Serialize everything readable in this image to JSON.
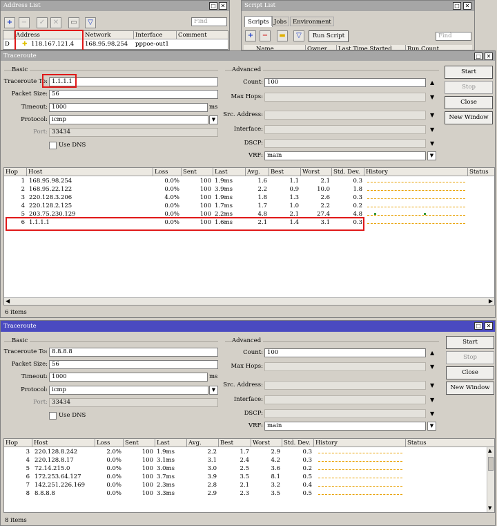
{
  "address_list": {
    "title": "Address List",
    "find_placeholder": "Find",
    "columns": [
      "Address",
      "Network",
      "Interface",
      "Comment"
    ],
    "row": {
      "flag": "D",
      "address": "118.167.121.4",
      "network": "168.95.98.254",
      "interface": "pppoe-out1",
      "comment": ""
    }
  },
  "script_list": {
    "title": "Script List",
    "tabs": [
      "Scripts",
      "Jobs",
      "Environment"
    ],
    "run_script": "Run Script",
    "find_placeholder": "Find",
    "columns": [
      "Name",
      "Owner",
      "Last Time Started",
      "Run Count"
    ]
  },
  "window_controls": {
    "restore": "□",
    "close": "✕"
  },
  "traceroute1": {
    "title": "Traceroute",
    "basic_label": "Basic",
    "advanced_label": "Advanced",
    "labels": {
      "to": "Traceroute To:",
      "packet_size": "Packet Size:",
      "timeout": "Timeout:",
      "protocol": "Protocol:",
      "port": "Port:",
      "use_dns": "Use DNS",
      "count": "Count:",
      "max_hops": "Max Hops:",
      "src_address": "Src. Address:",
      "interface": "Interface:",
      "dscp": "DSCP:",
      "vrf": "VRF:",
      "timeout_unit": "ms"
    },
    "values": {
      "to": "1.1.1.1",
      "packet_size": "56",
      "timeout": "1000",
      "protocol": "icmp",
      "port": "33434",
      "count": "100",
      "vrf": "main"
    },
    "buttons": {
      "start": "Start",
      "stop": "Stop",
      "close": "Close",
      "new_window": "New Window"
    },
    "columns": [
      "Hop",
      "Host",
      "Loss",
      "Sent",
      "Last",
      "Avg.",
      "Best",
      "Worst",
      "Std. Dev.",
      "History",
      "Status"
    ],
    "rows": [
      {
        "hop": "1",
        "host": "168.95.98.254",
        "loss": "0.0%",
        "sent": "100",
        "last": "1.9ms",
        "avg": "1.6",
        "best": "1.1",
        "worst": "2.1",
        "std": "0.3"
      },
      {
        "hop": "2",
        "host": "168.95.22.122",
        "loss": "0.0%",
        "sent": "100",
        "last": "3.9ms",
        "avg": "2.2",
        "best": "0.9",
        "worst": "10.0",
        "std": "1.8"
      },
      {
        "hop": "3",
        "host": "220.128.3.206",
        "loss": "4.0%",
        "sent": "100",
        "last": "1.9ms",
        "avg": "1.8",
        "best": "1.3",
        "worst": "2.6",
        "std": "0.3"
      },
      {
        "hop": "4",
        "host": "220.128.2.125",
        "loss": "0.0%",
        "sent": "100",
        "last": "1.7ms",
        "avg": "1.7",
        "best": "1.0",
        "worst": "2.2",
        "std": "0.2"
      },
      {
        "hop": "5",
        "host": "203.75.230.129",
        "loss": "0.0%",
        "sent": "100",
        "last": "2.2ms",
        "avg": "4.8",
        "best": "2.1",
        "worst": "27.4",
        "std": "4.8"
      },
      {
        "hop": "6",
        "host": "1.1.1.1",
        "loss": "0.0%",
        "sent": "100",
        "last": "1.6ms",
        "avg": "2.1",
        "best": "1.4",
        "worst": "3.1",
        "std": "0.3"
      }
    ],
    "items": "6 items"
  },
  "traceroute2": {
    "title": "Traceroute",
    "basic_label": "Basic",
    "advanced_label": "Advanced",
    "labels": {
      "to": "Traceroute To:",
      "packet_size": "Packet Size:",
      "timeout": "Timeout:",
      "protocol": "Protocol:",
      "port": "Port:",
      "use_dns": "Use DNS",
      "count": "Count:",
      "max_hops": "Max Hops:",
      "src_address": "Src. Address:",
      "interface": "Interface:",
      "dscp": "DSCP:",
      "vrf": "VRF:",
      "timeout_unit": "ms"
    },
    "values": {
      "to": "8.8.8.8",
      "packet_size": "56",
      "timeout": "1000",
      "protocol": "icmp",
      "port": "33434",
      "count": "100",
      "vrf": "main"
    },
    "buttons": {
      "start": "Start",
      "stop": "Stop",
      "close": "Close",
      "new_window": "New Window"
    },
    "columns": [
      "Hop",
      "Host",
      "Loss",
      "Sent",
      "Last",
      "Avg.",
      "Best",
      "Worst",
      "Std. Dev.",
      "History",
      "Status"
    ],
    "rows": [
      {
        "hop": "3",
        "host": "220.128.8.242",
        "loss": "2.0%",
        "sent": "100",
        "last": "1.9ms",
        "avg": "2.2",
        "best": "1.7",
        "worst": "2.9",
        "std": "0.3"
      },
      {
        "hop": "4",
        "host": "220.128.8.17",
        "loss": "0.0%",
        "sent": "100",
        "last": "3.1ms",
        "avg": "3.1",
        "best": "2.4",
        "worst": "4.2",
        "std": "0.3"
      },
      {
        "hop": "5",
        "host": "72.14.215.0",
        "loss": "0.0%",
        "sent": "100",
        "last": "3.0ms",
        "avg": "3.0",
        "best": "2.5",
        "worst": "3.6",
        "std": "0.2"
      },
      {
        "hop": "6",
        "host": "172.253.64.127",
        "loss": "0.0%",
        "sent": "100",
        "last": "3.7ms",
        "avg": "3.9",
        "best": "3.5",
        "worst": "8.1",
        "std": "0.5"
      },
      {
        "hop": "7",
        "host": "142.251.226.169",
        "loss": "0.0%",
        "sent": "100",
        "last": "2.3ms",
        "avg": "2.8",
        "best": "2.1",
        "worst": "3.2",
        "std": "0.4"
      },
      {
        "hop": "8",
        "host": "8.8.8.8",
        "loss": "0.0%",
        "sent": "100",
        "last": "3.3ms",
        "avg": "2.9",
        "best": "2.3",
        "worst": "3.5",
        "std": "0.5"
      }
    ],
    "items": "8 items"
  },
  "colors": {
    "active_title": "#4a4ac0",
    "inactive_title": "#a6a6a6",
    "highlight": "#e01818",
    "history_line": "#e8a000"
  }
}
